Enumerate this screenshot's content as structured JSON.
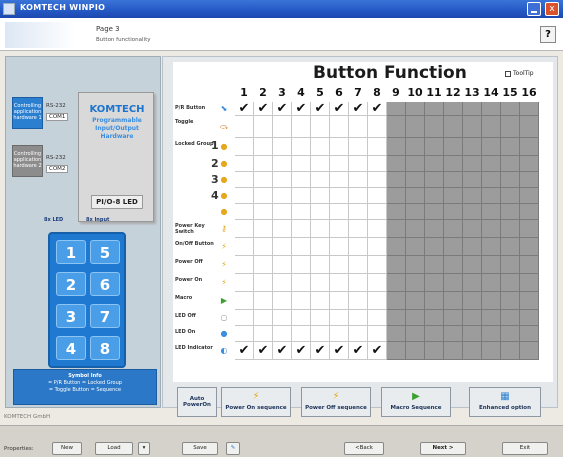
{
  "window": {
    "title": "KOMTECH WINPIO",
    "close_glyph": "x"
  },
  "header": {
    "page": "Page 3",
    "subtitle": "Button functionality",
    "help": "?"
  },
  "left_panel": {
    "controller_1": "Controlling application hardware 1",
    "controller_2": "Controlling application hardware 2",
    "rs_1": "RS-232",
    "com_1": "COM1",
    "rs_2": "RS-232",
    "com_2": "COM2",
    "kom_title": "KOMTECH",
    "kom_subtitle": "Programmable Input/Output Hardware",
    "model": "PI/O-8 LED",
    "led_label": "8x LED",
    "input_label": "8x Input",
    "keys": [
      "1",
      "5",
      "2",
      "6",
      "3",
      "7",
      "4",
      "8"
    ],
    "info_title": "Symbol Info",
    "info_line1": "= P/R Button   = Locked Group",
    "info_line2": "= Toggle Button   = Sequence"
  },
  "main": {
    "title": "Button Function",
    "tooltip_label": "ToolTip",
    "columns": [
      "1",
      "2",
      "3",
      "4",
      "5",
      "6",
      "7",
      "8",
      "9",
      "10",
      "11",
      "12",
      "13",
      "14",
      "15",
      "16"
    ],
    "active_columns": 8,
    "rows": [
      {
        "label": "P/R Button",
        "icon": "pr-button-icon",
        "checks": [
          1,
          1,
          1,
          1,
          1,
          1,
          1,
          1
        ]
      },
      {
        "label": "Toggle",
        "icon": "toggle-icon",
        "checks": []
      },
      {
        "label": "Locked Group",
        "icon": "locked-group-icon",
        "number": "1",
        "checks": []
      },
      {
        "label": "",
        "icon": "locked-group-icon",
        "number": "2",
        "checks": []
      },
      {
        "label": "",
        "icon": "locked-group-icon",
        "number": "3",
        "checks": []
      },
      {
        "label": "",
        "icon": "locked-group-icon",
        "number": "4",
        "checks": []
      },
      {
        "label": "",
        "icon": "locked-group-icon",
        "number": "",
        "checks": []
      },
      {
        "label": "Power Key Switch",
        "icon": "key-switch-icon",
        "checks": []
      },
      {
        "label": "On/Off Button",
        "icon": "onoff-icon",
        "checks": []
      },
      {
        "label": "Power Off",
        "icon": "power-off-icon",
        "checks": []
      },
      {
        "label": "Power On",
        "icon": "power-on-icon",
        "checks": []
      },
      {
        "label": "Macro",
        "icon": "macro-icon",
        "checks": []
      },
      {
        "label": "LED Off",
        "icon": "led-off-icon",
        "checks": []
      },
      {
        "label": "LED On",
        "icon": "led-on-icon",
        "checks": []
      },
      {
        "label": "LED Indicator",
        "icon": "led-indicator-icon",
        "checks": [
          1,
          1,
          1,
          1,
          1,
          1,
          1,
          1
        ]
      }
    ],
    "buttons": {
      "auto": "Auto PowerOn",
      "power_on": "Power On sequence",
      "power_off": "Power Off sequence",
      "macro": "Macro Sequence",
      "enhanced": "Enhanced option"
    },
    "check_glyph": "✔"
  },
  "status": "KOMTECH GmbH",
  "bottom": {
    "properties": "Properties:",
    "new": "New",
    "load": "Load",
    "save": "Save",
    "back": "<Back",
    "next": "Next >",
    "exit": "Exit",
    "dropdown": "▾"
  },
  "colors": {
    "accent": "#2a7fd1",
    "disabled": "#9c9c9c"
  }
}
